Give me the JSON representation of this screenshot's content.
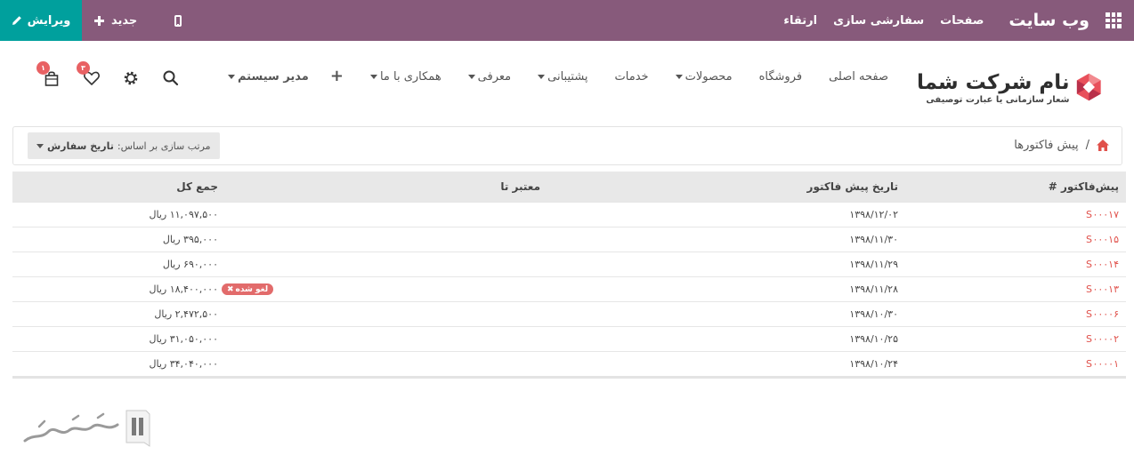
{
  "topbar": {
    "brand": "وب سایت",
    "menu": [
      "صفحات",
      "سفارشی سازی",
      "ارتقاء"
    ],
    "new_label": "جدید",
    "edit_label": "ویرایش",
    "color": "#875a7b",
    "edit_color": "#00a09d"
  },
  "header": {
    "logo_name": "نام شرکت شما",
    "logo_slogan": "شعار سازمانی یا عبارت توصیفی",
    "nav": [
      {
        "label": "صفحه اصلی",
        "dropdown": false
      },
      {
        "label": "فروشگاه",
        "dropdown": false
      },
      {
        "label": "محصولات",
        "dropdown": true
      },
      {
        "label": "خدمات",
        "dropdown": false
      },
      {
        "label": "پشتیبانی",
        "dropdown": true
      },
      {
        "label": "معرفی",
        "dropdown": true
      },
      {
        "label": "همکاری با ما",
        "dropdown": true
      }
    ],
    "admin_label": "مدیر سیستم",
    "wishlist_count": "۳",
    "cart_count": "۱"
  },
  "control": {
    "breadcrumb_current": "پیش فاکتورها",
    "breadcrumb_sep": "/",
    "sort_prefix": "مرتب سازی بر اساس:",
    "sort_value": "تاریخ سفارش"
  },
  "table": {
    "headers": {
      "number": "پیش‌فاکتور #",
      "date": "تاریخ پیش فاکتور",
      "valid": "معتبر تا",
      "total": "جمع کل"
    },
    "rows": [
      {
        "number": "S۰۰۰۱۷",
        "date": "۱۳۹۸/۱۲/۰۲",
        "status": "",
        "total": "۱۱,۰۹۷,۵۰۰ ریال"
      },
      {
        "number": "S۰۰۰۱۵",
        "date": "۱۳۹۸/۱۱/۳۰",
        "status": "",
        "total": "۳۹۵,۰۰۰ ریال"
      },
      {
        "number": "S۰۰۰۱۴",
        "date": "۱۳۹۸/۱۱/۲۹",
        "status": "",
        "total": "۶۹۰,۰۰۰ ریال"
      },
      {
        "number": "S۰۰۰۱۳",
        "date": "۱۳۹۸/۱۱/۲۸",
        "status": "لغو شده",
        "total": "۱۸,۴۰۰,۰۰۰ ریال"
      },
      {
        "number": "S۰۰۰۰۶",
        "date": "۱۳۹۸/۱۰/۳۰",
        "status": "",
        "total": "۲,۴۷۲,۵۰۰ ریال"
      },
      {
        "number": "S۰۰۰۰۲",
        "date": "۱۳۹۸/۱۰/۲۵",
        "status": "",
        "total": "۳۱,۰۵۰,۰۰۰ ریال"
      },
      {
        "number": "S۰۰۰۰۱",
        "date": "۱۳۹۸/۱۰/۲۴",
        "status": "",
        "total": "۳۴,۰۴۰,۰۰۰ ریال"
      }
    ]
  },
  "watermark": {
    "text": "تسهیل گستر"
  }
}
